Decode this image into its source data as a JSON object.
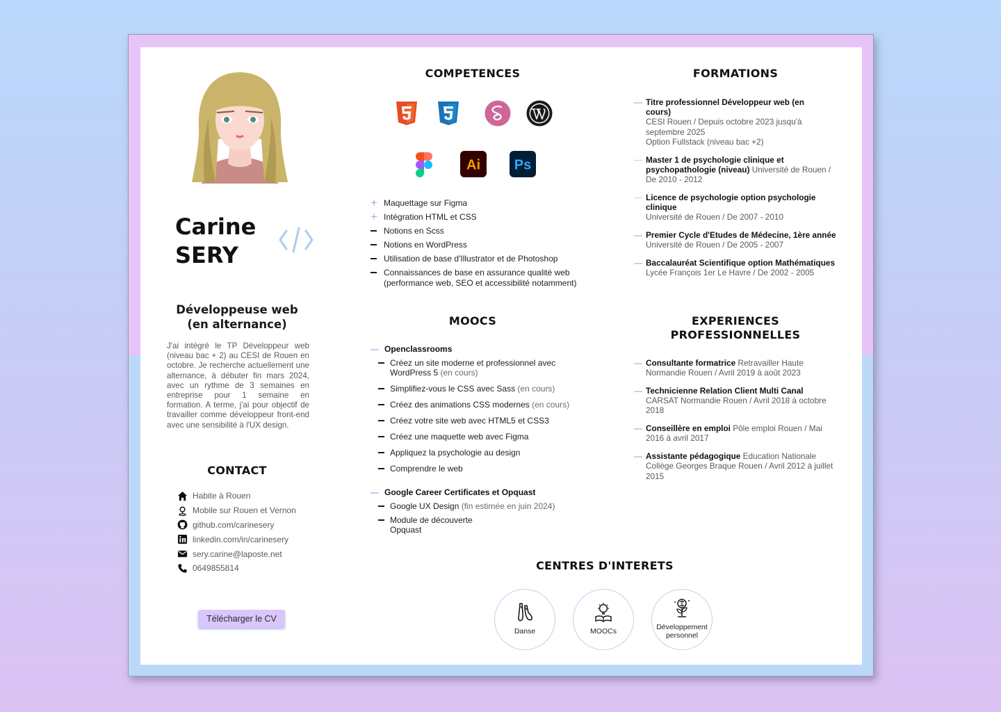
{
  "profile": {
    "first_name": "Carine",
    "last_name": "SERY",
    "job_title_line1": "Développeuse web",
    "job_title_line2": "(en alternance)",
    "intro": "J'ai intégré le TP Développeur web (niveau bac + 2) au CESI de Rouen en octobre. Je recherche actuellement une alternance, à débuter fin mars 2024, avec un rythme de 3 semaines en entreprise pour 1 semaine en formation. A terme, j'ai pour objectif de travailler comme développeur front-end avec une sensibilité à l'UX design."
  },
  "contact": {
    "title": "CONTACT",
    "items": [
      {
        "icon": "home-icon",
        "text": "Habite à Rouen"
      },
      {
        "icon": "location-pin-icon",
        "text": "Mobile sur Rouen et Vernon"
      },
      {
        "icon": "github-icon",
        "text": "github.com/carinesery"
      },
      {
        "icon": "linkedin-icon",
        "text": "linkedin.com/in/carinesery"
      },
      {
        "icon": "mail-icon",
        "text": "sery.carine@laposte.net"
      },
      {
        "icon": "phone-icon",
        "text": "0649855814"
      }
    ],
    "download_label": "Télécharger le CV"
  },
  "competences": {
    "title": "COMPETENCES",
    "icons": [
      {
        "name": "html5-icon",
        "label": "5",
        "color": "#e44d26"
      },
      {
        "name": "css3-icon",
        "label": "3",
        "color": "#1b73ba"
      },
      {
        "name": "sass-icon",
        "label": "S",
        "color": "#cd6799"
      },
      {
        "name": "wordpress-icon",
        "label": "W",
        "color": "#1a1a1a"
      },
      {
        "name": "figma-icon",
        "label": "",
        "color": "#f24e1e"
      },
      {
        "name": "illustrator-icon",
        "label": "Ai",
        "color": "#ff9a00"
      },
      {
        "name": "photoshop-icon",
        "label": "Ps",
        "color": "#31a8ff"
      }
    ],
    "items": [
      {
        "text": "Maquettage sur Figma",
        "marker": "plus"
      },
      {
        "text": "Intégration HTML et CSS",
        "marker": "plus"
      },
      {
        "text": "Notions en Scss",
        "marker": "dash"
      },
      {
        "text": "Notions en WordPress",
        "marker": "dash"
      },
      {
        "text": "Utilisation de base d'Illustrator et de Photoshop",
        "marker": "dash"
      },
      {
        "text": "Connaissances de base en assurance qualité web (performance web, SEO et accessibilité notamment)",
        "marker": "dash"
      }
    ]
  },
  "moocs": {
    "title": "MOOCS",
    "groups": [
      {
        "head": "Openclassrooms",
        "items": [
          {
            "text": "Créez un site moderne et professionnel avec WordPress 5",
            "note": " (en cours)"
          },
          {
            "text": "Simplifiez-vous le CSS avec Sass",
            "note": " (en cours)"
          },
          {
            "text": "Créez des animations CSS modernes",
            "note": " (en cours)"
          },
          {
            "text": "Créez votre site web avec HTML5 et CSS3",
            "note": ""
          },
          {
            "text": "Créez une maquette web avec Figma",
            "note": ""
          },
          {
            "text": "Appliquez la psychologie au design",
            "note": ""
          },
          {
            "text": "Comprendre le web",
            "note": ""
          }
        ]
      },
      {
        "head": "Google Career Certificates et Opquast",
        "items": [
          {
            "text": "Google UX Design",
            "note": " (fin estimée en juin 2024)"
          },
          {
            "text": "Module de découverte Opquast",
            "note": ""
          }
        ]
      }
    ]
  },
  "formations": {
    "title": "FORMATIONS",
    "items": [
      {
        "title": "Titre professionnel Développeur web (en cours)",
        "detail": "CESI Rouen / Depuis octobre 2023 jusqu'à septembre 2025",
        "extra": "Option Fullstack (niveau bac +2)"
      },
      {
        "title": "Master 1 de psychologie clinique et psychopathologie (niveau)",
        "detail": " Université de Rouen / De 2010 - 2012",
        "extra": ""
      },
      {
        "title": "Licence de psychologie option psychologie clinique",
        "detail": "Université de Rouen / De 2007 - 2010",
        "extra": ""
      },
      {
        "title": "Premier Cycle d'Etudes de Médecine, 1ère année",
        "detail": "Université de Rouen / De 2005 - 2007",
        "extra": ""
      },
      {
        "title": "Baccalauréat Scientifique option Mathématiques",
        "detail": "Lycée François 1er Le Havre / De 2002 - 2005",
        "extra": ""
      }
    ]
  },
  "experiences": {
    "title_line1": "EXPERIENCES",
    "title_line2": "PROFESSIONNELLES",
    "items": [
      {
        "title": "Consultante formatrice",
        "detail": " Retravailler Haute Normandie Rouen / Avril 2019 à août 2023"
      },
      {
        "title": "Technicienne Relation Client Multi Canal",
        "detail": " CARSAT Normandie Rouen / Avril 2018 à octobre 2018"
      },
      {
        "title": "Conseillère en emploi",
        "detail": " Pôle emploi Rouen / Mai 2016 à avril 2017"
      },
      {
        "title": "Assistante pédagogique",
        "detail": " Education Nationale Collège Georges Braque Rouen / Avril 2012 à juillet 2015"
      }
    ]
  },
  "interests": {
    "title": "CENTRES D'INTERETS",
    "items": [
      {
        "icon": "dance-shoes-icon",
        "label": "Danse"
      },
      {
        "icon": "lightbulb-book-icon",
        "label": "MOOCs"
      },
      {
        "icon": "growth-brain-icon",
        "label": "Développement personnel"
      }
    ]
  },
  "colors": {
    "accent_pink": "#e6c4f7",
    "accent_blue": "#bcd8f8",
    "button": "#d9c6fb"
  }
}
